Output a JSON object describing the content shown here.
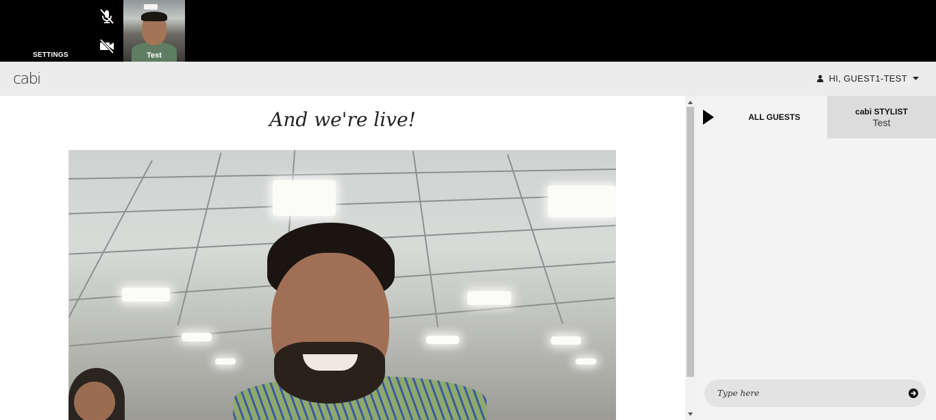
{
  "topbar": {
    "settings_label": "SETTINGS",
    "mic_icon": "mic-muted-icon",
    "camera_icon": "camera-off-icon",
    "thumbnail_name": "Test"
  },
  "header": {
    "logo": "cabi",
    "user_icon": "user-icon",
    "user_label": "HI, GUEST1-TEST",
    "caret_icon": "caret-down-icon"
  },
  "main": {
    "title": "And we're live!"
  },
  "chat": {
    "toggle_icon": "play-icon",
    "tab_all_guests": "ALL GUESTS",
    "tab_stylist_title": "cabi STYLIST",
    "tab_stylist_name": "Test",
    "input_placeholder": "Type here",
    "send_icon": "arrow-right-circle-icon"
  },
  "colors": {
    "topbar": "#000000",
    "header": "#ececec",
    "chat_panel": "#f3f3f3",
    "stylist_tab": "#dcdcdc"
  }
}
